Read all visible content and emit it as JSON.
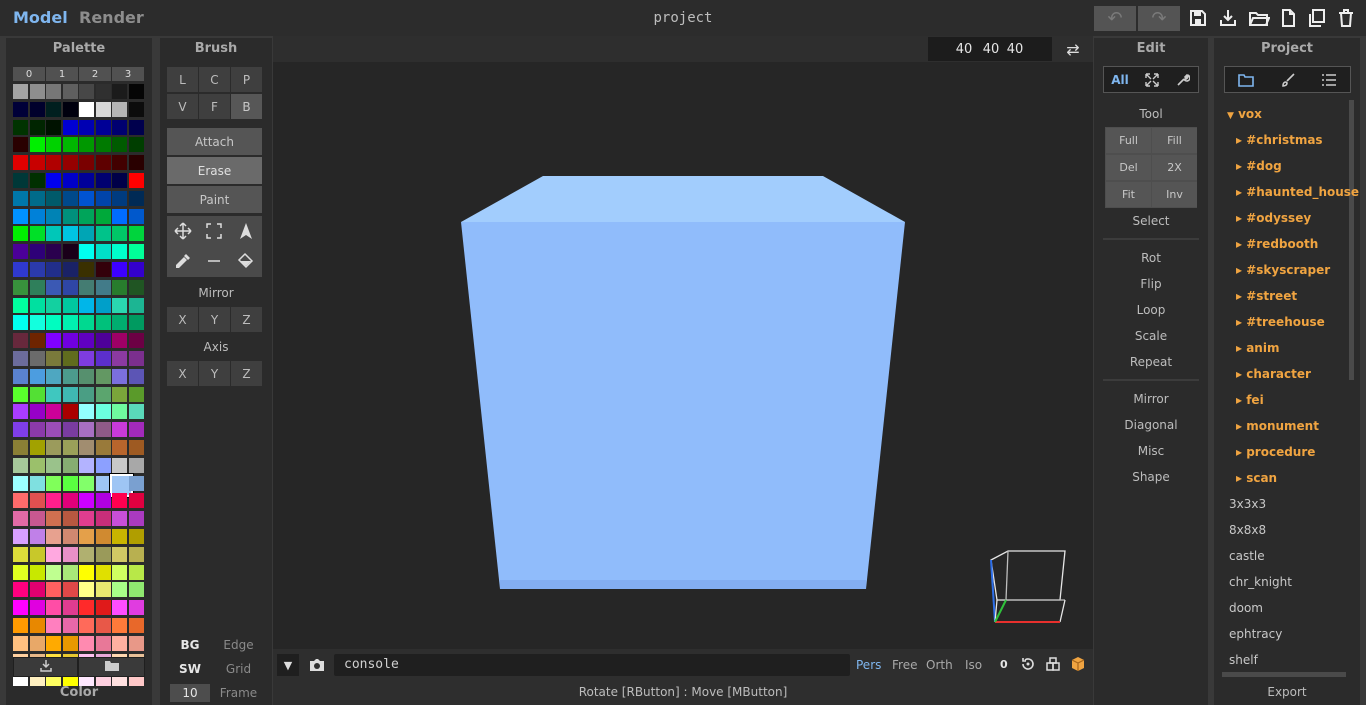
{
  "tabs": {
    "model": "Model",
    "render": "Render"
  },
  "project_title": "project",
  "toolbar_icons": [
    "undo-icon",
    "redo-icon",
    "save-icon",
    "import-icon",
    "open-folder-icon",
    "new-file-icon",
    "duplicate-icon",
    "trash-icon"
  ],
  "palette": {
    "title": "Palette",
    "columns": [
      "0",
      "1",
      "2",
      "3"
    ],
    "footer": "Color",
    "selected": "#9ec5f4"
  },
  "brush": {
    "title": "Brush",
    "modes_row1": [
      "L",
      "C",
      "P"
    ],
    "modes_row2": [
      "V",
      "F",
      "B"
    ],
    "actions": [
      "Attach",
      "Erase",
      "Paint"
    ],
    "mirror_label": "Mirror",
    "mirror": [
      "X",
      "Y",
      "Z"
    ],
    "axis_label": "Axis",
    "axis": [
      "X",
      "Y",
      "Z"
    ],
    "bg": "BG",
    "edge": "Edge",
    "sw": "SW",
    "grid": "Grid",
    "frame_value": "10",
    "frame": "Frame"
  },
  "dims": [
    "40",
    "40",
    "40"
  ],
  "console": {
    "placeholder": "console"
  },
  "views": [
    "Pers",
    "Free",
    "Orth",
    "Iso"
  ],
  "view_value": "0",
  "status": "Rotate [RButton] : Move [MButton]",
  "edit": {
    "title": "Edit",
    "filter_all": "All",
    "tool_label": "Tool",
    "tools": [
      [
        "Full",
        "Fill"
      ],
      [
        "Del",
        "2X"
      ],
      [
        "Fit",
        "Inv"
      ]
    ],
    "select": "Select",
    "ops1": [
      "Rot",
      "Flip",
      "Loop",
      "Scale",
      "Repeat"
    ],
    "ops2": [
      "Mirror",
      "Diagonal",
      "Misc",
      "Shape"
    ]
  },
  "project": {
    "title": "Project",
    "root": "vox",
    "folders": [
      "#christmas",
      "#dog",
      "#haunted_house",
      "#odyssey",
      "#redbooth",
      "#skyscraper",
      "#street",
      "#treehouse",
      "anim",
      "character",
      "fei",
      "monument",
      "procedure",
      "scan"
    ],
    "files": [
      "3x3x3",
      "8x8x8",
      "castle",
      "chr_knight",
      "doom",
      "ephtracy",
      "shelf"
    ],
    "export": "Export"
  },
  "colors": {
    "accent": "#7fb6ef",
    "folder": "#f0a441",
    "cube_front": "#90bcfb",
    "cube_top": "#a2cdfd"
  }
}
